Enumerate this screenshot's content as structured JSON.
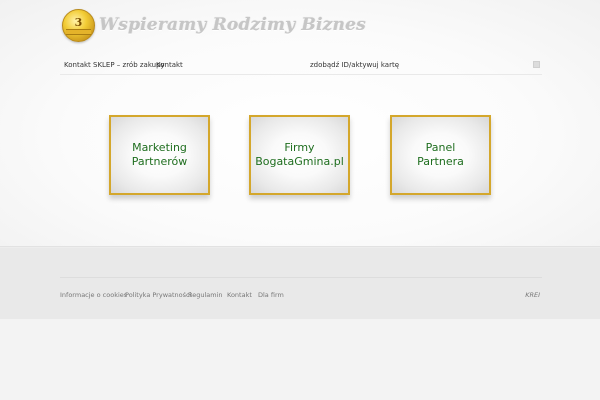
{
  "header": {
    "coin_number": "3",
    "logo_text": "Wspieramy Rodzimy Biznes"
  },
  "nav": {
    "items": [
      "Kontakt",
      "SKLEP – zrób zakupy",
      "Kontakt",
      "zdobądź ID/aktywuj kartę"
    ],
    "right_icon": "small-square-icon"
  },
  "tiles": [
    {
      "label": "Marketing\nPartnerów"
    },
    {
      "label": "Firmy\nBogataGmina.pl"
    },
    {
      "label": "Panel\nPartnera"
    }
  ],
  "footer": {
    "links": [
      "Informacje o cookies",
      "Polityka Prywatności",
      "Regulamin",
      "Kontakt",
      "Dla firm"
    ],
    "credit": "KREI"
  },
  "colors": {
    "tile_border": "#d4a72c",
    "tile_text": "#1f6e1f",
    "coin": "#f2cc35"
  }
}
